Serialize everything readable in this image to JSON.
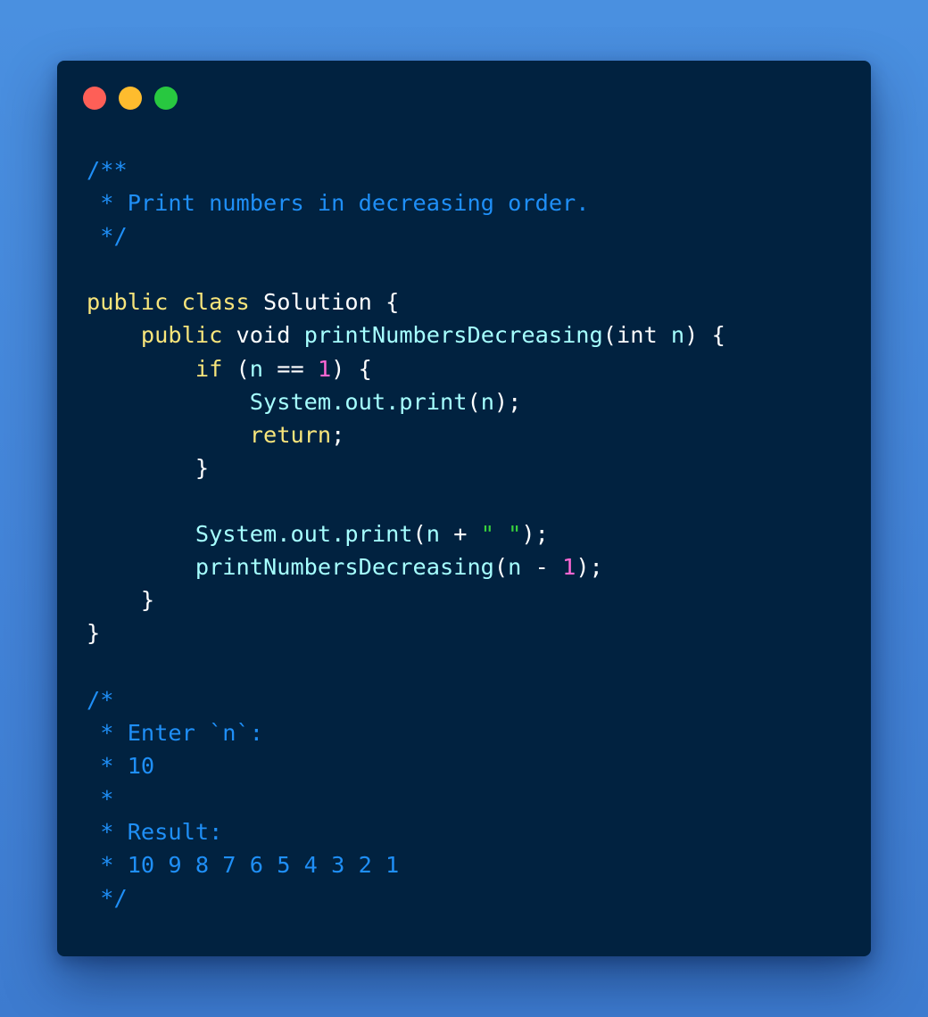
{
  "colors": {
    "background": "#4a90e0",
    "window": "#012240",
    "close_dot": "#fe5f57",
    "minimize_dot": "#febc2e",
    "maximize_dot": "#28c840",
    "comment": "#1f8ff7",
    "keyword": "#f8e57b",
    "function": "#a6ffff",
    "number": "#ff67d4",
    "string": "#39d33c",
    "plain": "#ffffff"
  },
  "code_lines": [
    [
      {
        "t": "/**",
        "c": "comment"
      }
    ],
    [
      {
        "t": " * Print numbers in decreasing order.",
        "c": "comment"
      }
    ],
    [
      {
        "t": " */",
        "c": "comment"
      }
    ],
    [],
    [
      {
        "t": "public",
        "c": "keyword"
      },
      {
        "t": " ",
        "c": "plain"
      },
      {
        "t": "class",
        "c": "keyword"
      },
      {
        "t": " Solution {",
        "c": "plain"
      }
    ],
    [
      {
        "t": "    ",
        "c": "plain"
      },
      {
        "t": "public",
        "c": "keyword"
      },
      {
        "t": " void ",
        "c": "plain"
      },
      {
        "t": "printNumbersDecreasing",
        "c": "function"
      },
      {
        "t": "(int ",
        "c": "plain"
      },
      {
        "t": "n",
        "c": "function"
      },
      {
        "t": ") {",
        "c": "plain"
      }
    ],
    [
      {
        "t": "        ",
        "c": "plain"
      },
      {
        "t": "if",
        "c": "keyword"
      },
      {
        "t": " (",
        "c": "plain"
      },
      {
        "t": "n",
        "c": "function"
      },
      {
        "t": " == ",
        "c": "plain"
      },
      {
        "t": "1",
        "c": "number"
      },
      {
        "t": ") {",
        "c": "plain"
      }
    ],
    [
      {
        "t": "            ",
        "c": "plain"
      },
      {
        "t": "System.out.print",
        "c": "function"
      },
      {
        "t": "(",
        "c": "plain"
      },
      {
        "t": "n",
        "c": "function"
      },
      {
        "t": ");",
        "c": "plain"
      }
    ],
    [
      {
        "t": "            ",
        "c": "plain"
      },
      {
        "t": "return",
        "c": "keyword"
      },
      {
        "t": ";",
        "c": "plain"
      }
    ],
    [
      {
        "t": "        }",
        "c": "plain"
      }
    ],
    [],
    [
      {
        "t": "        ",
        "c": "plain"
      },
      {
        "t": "System.out.print",
        "c": "function"
      },
      {
        "t": "(",
        "c": "plain"
      },
      {
        "t": "n",
        "c": "function"
      },
      {
        "t": " + ",
        "c": "plain"
      },
      {
        "t": "\" \"",
        "c": "string"
      },
      {
        "t": ");",
        "c": "plain"
      }
    ],
    [
      {
        "t": "        ",
        "c": "plain"
      },
      {
        "t": "printNumbersDecreasing",
        "c": "function"
      },
      {
        "t": "(",
        "c": "plain"
      },
      {
        "t": "n",
        "c": "function"
      },
      {
        "t": " - ",
        "c": "plain"
      },
      {
        "t": "1",
        "c": "number"
      },
      {
        "t": ");",
        "c": "plain"
      }
    ],
    [
      {
        "t": "    }",
        "c": "plain"
      }
    ],
    [
      {
        "t": "}",
        "c": "plain"
      }
    ],
    [],
    [
      {
        "t": "/*",
        "c": "comment"
      }
    ],
    [
      {
        "t": " * Enter `n`:",
        "c": "comment"
      }
    ],
    [
      {
        "t": " * 10",
        "c": "comment"
      }
    ],
    [
      {
        "t": " *",
        "c": "comment"
      }
    ],
    [
      {
        "t": " * Result:",
        "c": "comment"
      }
    ],
    [
      {
        "t": " * 10 9 8 7 6 5 4 3 2 1",
        "c": "comment"
      }
    ],
    [
      {
        "t": " */",
        "c": "comment"
      }
    ]
  ]
}
